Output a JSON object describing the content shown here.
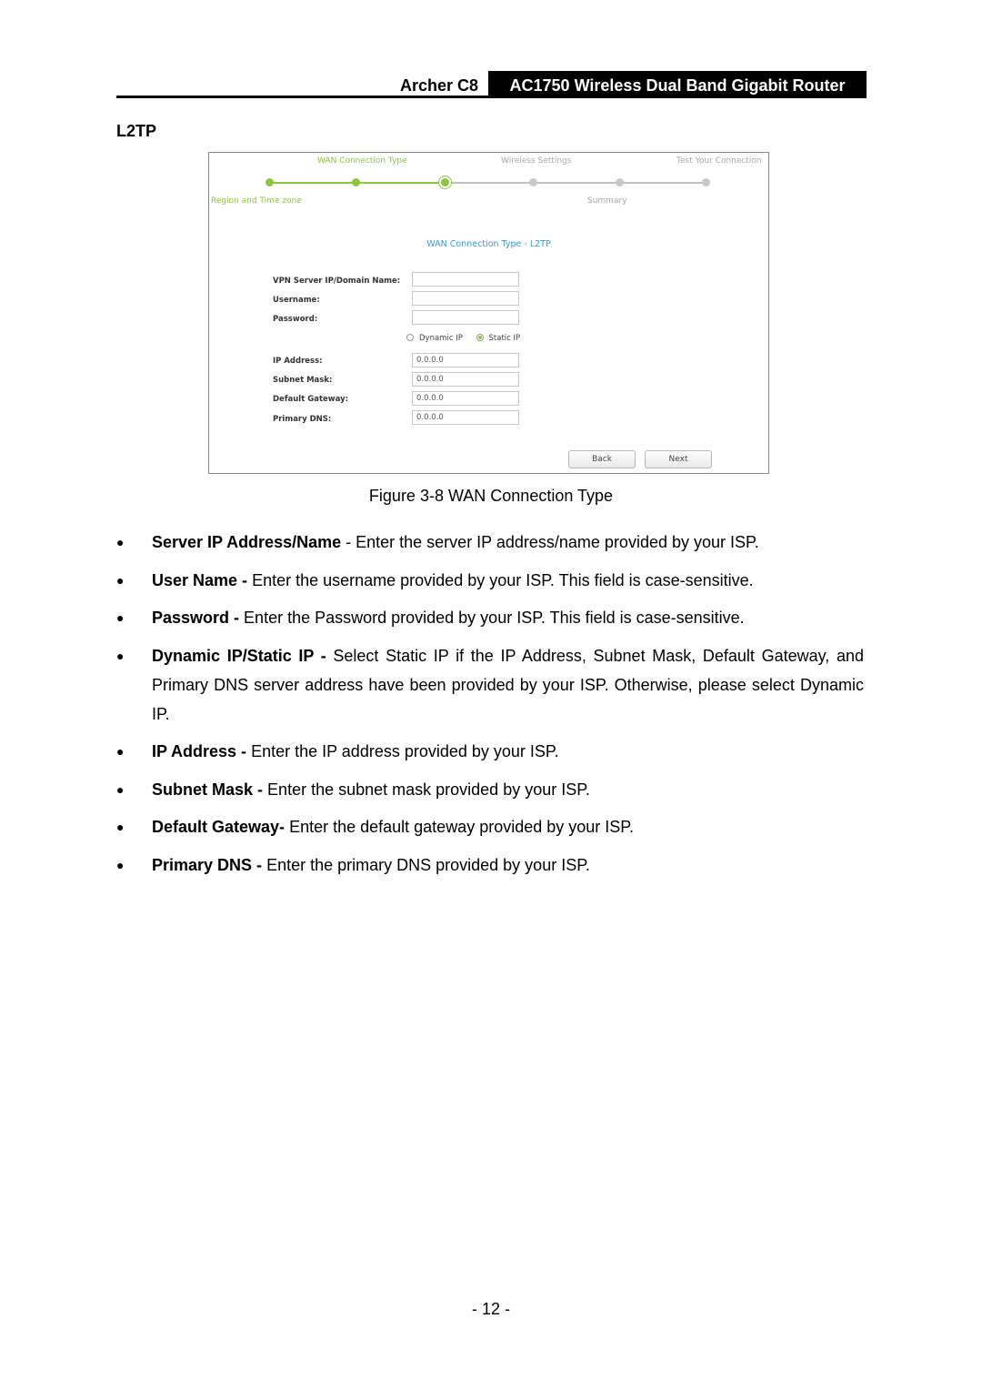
{
  "header": {
    "model": "Archer C8",
    "product": "AC1750 Wireless Dual Band Gigabit Router"
  },
  "section_title": "L2TP",
  "screenshot": {
    "steps_top": [
      {
        "label": "WAN Connection Type",
        "state": "done"
      },
      {
        "label": "Wireless Settings",
        "state": "todo"
      },
      {
        "label": "Test Your Connection",
        "state": "todo"
      }
    ],
    "steps_bottom": [
      {
        "label": "Region and Time zone",
        "state": "done"
      },
      {
        "label": "Summary",
        "state": "todo"
      }
    ],
    "progress": {
      "completed_steps": 2,
      "current_step": 3,
      "total_steps": 6
    },
    "form_title": "WAN Connection Type - L2TP",
    "fields_top": [
      {
        "label": "VPN Server IP/Domain Name:",
        "value": ""
      },
      {
        "label": "Username:",
        "value": ""
      },
      {
        "label": "Password:",
        "value": ""
      }
    ],
    "ip_mode": {
      "options": [
        "Dynamic IP",
        "Static IP"
      ],
      "selected": "Static IP"
    },
    "fields_static": [
      {
        "label": "IP Address:",
        "value": "0.0.0.0"
      },
      {
        "label": "Subnet Mask:",
        "value": "0.0.0.0"
      },
      {
        "label": "Default Gateway:",
        "value": "0.0.0.0"
      },
      {
        "label": "Primary DNS:",
        "value": "0.0.0.0"
      }
    ],
    "buttons": {
      "back": "Back",
      "next": "Next"
    },
    "colors": {
      "accent_green": "#8cc63f",
      "title_blue": "#3a9ad4",
      "inactive_gray": "#c0c0c0"
    }
  },
  "caption": "Figure 3-8 WAN Connection Type",
  "bullets": [
    {
      "term": "Server IP Address/Name",
      "sep": " - ",
      "text": "Enter the server IP address/name provided by your ISP."
    },
    {
      "term": "User Name -",
      "sep": " ",
      "text": "Enter the username provided by your ISP. This field is case-sensitive."
    },
    {
      "term": "Password -",
      "sep": " ",
      "text": "Enter the Password provided by your ISP. This field is case-sensitive."
    },
    {
      "term": "Dynamic IP/Static IP -",
      "sep": " ",
      "text": "Select Static IP if the IP Address, Subnet Mask, Default Gateway, and Primary DNS server address have been provided by your ISP. Otherwise, please select Dynamic IP."
    },
    {
      "term": "IP Address -",
      "sep": " ",
      "text": "Enter the IP address provided by your ISP."
    },
    {
      "term": "Subnet Mask -",
      "sep": " ",
      "text": "Enter the subnet mask provided by your ISP."
    },
    {
      "term": "Default Gateway-",
      "sep": " ",
      "text": "Enter the default gateway provided by your ISP."
    },
    {
      "term": "Primary DNS -",
      "sep": " ",
      "text": "Enter the primary DNS provided by your ISP."
    }
  ],
  "bullet_glyph": "●",
  "page_number": "- 12 -"
}
